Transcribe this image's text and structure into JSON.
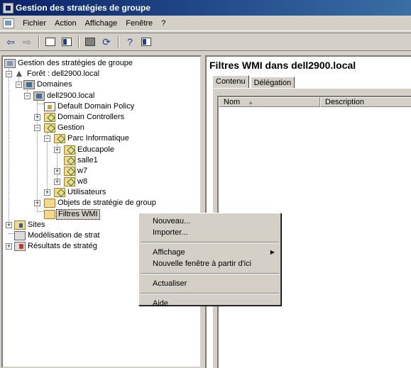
{
  "window": {
    "title": "Gestion des stratégies de groupe"
  },
  "menubar": {
    "items": [
      {
        "label": "Fichier"
      },
      {
        "label": "Action"
      },
      {
        "label": "Affichage"
      },
      {
        "label": "Fenêtre"
      },
      {
        "label": "?"
      }
    ]
  },
  "toolbar": {
    "buttons": [
      {
        "icon": "back-arrow-icon"
      },
      {
        "icon": "forward-arrow-icon"
      },
      {
        "icon": "up-folder-icon"
      },
      {
        "icon": "show-hide-tree-icon"
      },
      {
        "icon": "delete-icon"
      },
      {
        "icon": "refresh-icon"
      },
      {
        "icon": "help-icon"
      },
      {
        "icon": "properties-icon"
      }
    ]
  },
  "tree": {
    "root": "Gestion des stratégies de groupe",
    "forest": "Forêt : dell2900.local",
    "domains": "Domaines",
    "domain": "dell2900.local",
    "default_policy": "Default Domain Policy",
    "domain_controllers": "Domain Controllers",
    "gestion": "Gestion",
    "parc": "Parc Informatique",
    "educapole": "Educapole",
    "salle1": "salle1",
    "w7": "w7",
    "w8": "w8",
    "utilisateurs": "Utilisateurs",
    "gpo_objects": "Objets de stratégie de group",
    "wmi_filters": "Filtres WMI",
    "sites": "Sites",
    "modeling": "Modélisation de strat",
    "results": "Résultats de stratég"
  },
  "right_pane": {
    "title": "Filtres WMI dans dell2900.local",
    "tabs": [
      {
        "label": "Contenu"
      },
      {
        "label": "Délégation"
      }
    ],
    "columns": [
      {
        "label": "Nom"
      },
      {
        "label": "Description"
      }
    ]
  },
  "context_menu": {
    "items": {
      "nouveau": "Nouveau...",
      "importer": "Importer...",
      "affichage": "Affichage",
      "nouvelle_fenetre": "Nouvelle fenêtre à partir d'ici",
      "actualiser": "Actualiser",
      "aide": "Aide"
    }
  },
  "colors": {
    "titlebar": "#0a246a",
    "face": "#d4d0c8",
    "folder": "#f5d98b"
  }
}
